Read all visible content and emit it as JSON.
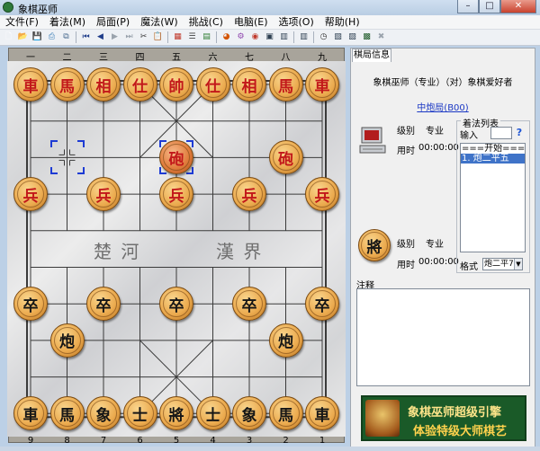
{
  "window": {
    "title": "象棋巫师",
    "min_label": "–",
    "max_label": "□",
    "close_label": "✕"
  },
  "menu": [
    "文件(F)",
    "着法(M)",
    "局面(P)",
    "魔法(W)",
    "挑战(C)",
    "电脑(E)",
    "选项(O)",
    "帮助(H)"
  ],
  "toolbar": [
    {
      "icon": "new-icon",
      "glyph": "🗋",
      "color": "#ffffff"
    },
    {
      "icon": "open-icon",
      "glyph": "📂",
      "color": "#e8c35a"
    },
    {
      "icon": "save-icon",
      "glyph": "💾",
      "color": "#7a8fb0"
    },
    {
      "icon": "print-icon",
      "glyph": "⎙",
      "color": "#3b7fb8"
    },
    {
      "icon": "copy-icon",
      "glyph": "⧉",
      "color": "#4a6b8e"
    },
    {
      "sep": true
    },
    {
      "icon": "first-move-icon",
      "glyph": "⏮",
      "color": "#1f3d8a"
    },
    {
      "icon": "prev-move-icon",
      "glyph": "◀",
      "color": "#1f3d8a"
    },
    {
      "icon": "next-move-icon",
      "glyph": "▶",
      "color": "#9aa3ad"
    },
    {
      "icon": "last-move-icon",
      "glyph": "⏭",
      "color": "#9aa3ad"
    },
    {
      "icon": "cut-icon",
      "glyph": "✂",
      "color": "#333333"
    },
    {
      "icon": "clipboard-icon",
      "glyph": "📋",
      "color": "#333333"
    },
    {
      "sep": true
    },
    {
      "icon": "edit-board-icon",
      "glyph": "▦",
      "color": "#c0392b"
    },
    {
      "icon": "tree-icon",
      "glyph": "☰",
      "color": "#444444"
    },
    {
      "icon": "library-icon",
      "glyph": "▤",
      "color": "#2e7d32"
    },
    {
      "sep": true
    },
    {
      "icon": "color-icon",
      "glyph": "◕",
      "color": "#d35400"
    },
    {
      "icon": "engine-icon",
      "glyph": "⚙",
      "color": "#8e44ad"
    },
    {
      "icon": "eye-icon",
      "glyph": "◉",
      "color": "#c0392b"
    },
    {
      "icon": "document-icon",
      "glyph": "▣",
      "color": "#2c3e50"
    },
    {
      "icon": "analyze-icon",
      "glyph": "▥",
      "color": "#2c3e50"
    },
    {
      "sep": true
    },
    {
      "icon": "book-icon",
      "glyph": "▥",
      "color": "#2c3e50"
    },
    {
      "sep": true
    },
    {
      "icon": "clock-icon",
      "glyph": "◷",
      "color": "#333333"
    },
    {
      "icon": "layout-icon",
      "glyph": "▧",
      "color": "#2c3e50"
    },
    {
      "icon": "panel-icon",
      "glyph": "▨",
      "color": "#2c3e50"
    },
    {
      "icon": "terminal-icon",
      "glyph": "▩",
      "color": "#1e5b2a"
    },
    {
      "icon": "stop-icon",
      "glyph": "✖",
      "color": "#9aa3ad"
    }
  ],
  "board": {
    "top_coords": [
      "一",
      "二",
      "三",
      "四",
      "五",
      "六",
      "七",
      "八",
      "九"
    ],
    "bottom_coords": [
      "9",
      "8",
      "7",
      "6",
      "5",
      "4",
      "3",
      "2",
      "1"
    ],
    "river_left": "楚 河",
    "river_right": "漢 界",
    "pieces": [
      {
        "char": "車",
        "side": "red",
        "file": 0,
        "rank": 0
      },
      {
        "char": "馬",
        "side": "red",
        "file": 1,
        "rank": 0
      },
      {
        "char": "相",
        "side": "red",
        "file": 2,
        "rank": 0
      },
      {
        "char": "仕",
        "side": "red",
        "file": 3,
        "rank": 0
      },
      {
        "char": "帥",
        "side": "red",
        "file": 4,
        "rank": 0
      },
      {
        "char": "仕",
        "side": "red",
        "file": 5,
        "rank": 0
      },
      {
        "char": "相",
        "side": "red",
        "file": 6,
        "rank": 0
      },
      {
        "char": "馬",
        "side": "red",
        "file": 7,
        "rank": 0
      },
      {
        "char": "車",
        "side": "red",
        "file": 8,
        "rank": 0
      },
      {
        "char": "砲",
        "side": "red",
        "file": 4,
        "rank": 2,
        "selected": true
      },
      {
        "char": "砲",
        "side": "red",
        "file": 7,
        "rank": 2
      },
      {
        "char": "兵",
        "side": "red",
        "file": 0,
        "rank": 3
      },
      {
        "char": "兵",
        "side": "red",
        "file": 2,
        "rank": 3
      },
      {
        "char": "兵",
        "side": "red",
        "file": 4,
        "rank": 3
      },
      {
        "char": "兵",
        "side": "red",
        "file": 6,
        "rank": 3
      },
      {
        "char": "兵",
        "side": "red",
        "file": 8,
        "rank": 3
      },
      {
        "char": "卒",
        "side": "black",
        "file": 0,
        "rank": 6
      },
      {
        "char": "卒",
        "side": "black",
        "file": 2,
        "rank": 6
      },
      {
        "char": "卒",
        "side": "black",
        "file": 4,
        "rank": 6
      },
      {
        "char": "卒",
        "side": "black",
        "file": 6,
        "rank": 6
      },
      {
        "char": "卒",
        "side": "black",
        "file": 8,
        "rank": 6
      },
      {
        "char": "炮",
        "side": "black",
        "file": 1,
        "rank": 7
      },
      {
        "char": "炮",
        "side": "black",
        "file": 7,
        "rank": 7
      },
      {
        "char": "車",
        "side": "black",
        "file": 0,
        "rank": 9
      },
      {
        "char": "馬",
        "side": "black",
        "file": 1,
        "rank": 9
      },
      {
        "char": "象",
        "side": "black",
        "file": 2,
        "rank": 9
      },
      {
        "char": "士",
        "side": "black",
        "file": 3,
        "rank": 9
      },
      {
        "char": "將",
        "side": "black",
        "file": 4,
        "rank": 9
      },
      {
        "char": "士",
        "side": "black",
        "file": 5,
        "rank": 9
      },
      {
        "char": "象",
        "side": "black",
        "file": 6,
        "rank": 9
      },
      {
        "char": "馬",
        "side": "black",
        "file": 7,
        "rank": 9
      },
      {
        "char": "車",
        "side": "black",
        "file": 8,
        "rank": 9
      }
    ],
    "last_move_from": {
      "file": 1,
      "rank": 2
    },
    "last_move_to": {
      "file": 4,
      "rank": 2
    }
  },
  "panel": {
    "tab_label": "棋局信息",
    "match_title": "象棋巫师（专业）（对）象棋爱好者",
    "opening": "中炮局(B00)",
    "top_player": {
      "level_label": "级别",
      "level_value": "专业",
      "time_label": "用时",
      "time_value": "00:00:00"
    },
    "bottom_player": {
      "avatar": "將",
      "level_label": "级别",
      "level_value": "专业",
      "time_label": "用时",
      "time_value": "00:00:00"
    },
    "move_list_title": "着法列表",
    "input_label": "输入",
    "help_label": "?",
    "moves": [
      "===开始===",
      "1. 炮二平五"
    ],
    "format_label": "格式",
    "format_value": "炮二平7",
    "notes_label": "注释"
  },
  "banner": {
    "line1": "象棋巫师超级引擎",
    "line2": "体验特级大师棋艺"
  }
}
